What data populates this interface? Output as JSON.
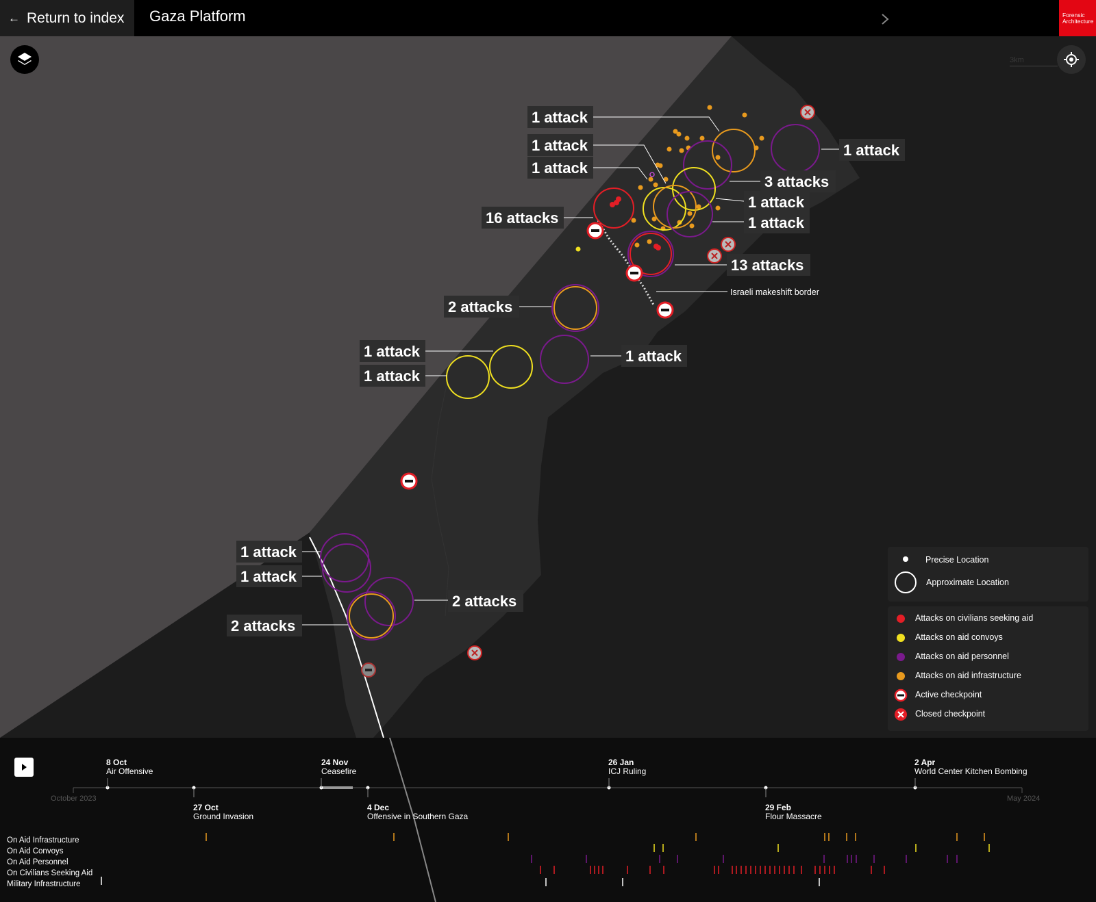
{
  "header": {
    "back_label": "Return to index",
    "title": "Gaza Platform",
    "logo_text": "Forensic Architecture"
  },
  "map": {
    "scale_label": "3km",
    "border_label": "Israeli makeshift border",
    "colors": {
      "sea": "#4a4748",
      "land": "#1c1c1c",
      "strip": "#2b2b2b",
      "civilians": "#e41e26",
      "convoys": "#f0e020",
      "personnel": "#7a1a8c",
      "infrastructure": "#e89a1e"
    },
    "labels": [
      {
        "text": "1 attack"
      },
      {
        "text": "1 attack"
      },
      {
        "text": "1 attack"
      },
      {
        "text": "16 attacks"
      },
      {
        "text": "1 attack"
      },
      {
        "text": "3 attacks"
      },
      {
        "text": "1 attack"
      },
      {
        "text": "1 attack"
      },
      {
        "text": "13 attacks"
      },
      {
        "text": "2 attacks"
      },
      {
        "text": "1 attack"
      },
      {
        "text": "1 attack"
      },
      {
        "text": "1 attack"
      },
      {
        "text": "1 attack"
      },
      {
        "text": "1 attack"
      },
      {
        "text": "2 attacks"
      },
      {
        "text": "2 attacks"
      }
    ]
  },
  "legend": {
    "location": [
      {
        "label": "Precise Location",
        "kind": "dot"
      },
      {
        "label": "Approximate Location",
        "kind": "ring"
      }
    ],
    "categories": [
      {
        "label": "Attacks on civilians seeking aid",
        "color": "#e41e26"
      },
      {
        "label": "Attacks on aid convoys",
        "color": "#f0e020"
      },
      {
        "label": "Attacks on aid personnel",
        "color": "#7a1a8c"
      },
      {
        "label": "Attacks on aid infrastructure",
        "color": "#e89a1e"
      },
      {
        "label": "Active checkpoint",
        "icon": "active-checkpoint-icon"
      },
      {
        "label": "Closed checkpoint",
        "icon": "closed-checkpoint-icon"
      }
    ]
  },
  "timeline": {
    "start_label": "October 2023",
    "end_label": "May 2024",
    "events_top": [
      {
        "date": "8 Oct",
        "name": "Air Offensive"
      },
      {
        "date": "24 Nov",
        "name": "Ceasefire"
      },
      {
        "date": "26 Jan",
        "name": "ICJ Ruling"
      },
      {
        "date": "2 Apr",
        "name": "World Center Kitchen Bombing"
      }
    ],
    "events_bottom": [
      {
        "date": "27 Oct",
        "name": "Ground Invasion"
      },
      {
        "date": "4 Dec",
        "name": "Offensive in Southern Gaza"
      },
      {
        "date": "29 Feb",
        "name": "Flour Massacre"
      }
    ],
    "categories": [
      {
        "label": "On Aid Infrastructure",
        "color": "#e89a1e"
      },
      {
        "label": "On Aid Convoys",
        "color": "#f0e020"
      },
      {
        "label": "On Aid Personnel",
        "color": "#7a1a8c"
      },
      {
        "label": "On Civilians Seeking Aid",
        "color": "#e41e26"
      },
      {
        "label": "Military Infrastructure",
        "color": "#ffffff"
      }
    ]
  }
}
